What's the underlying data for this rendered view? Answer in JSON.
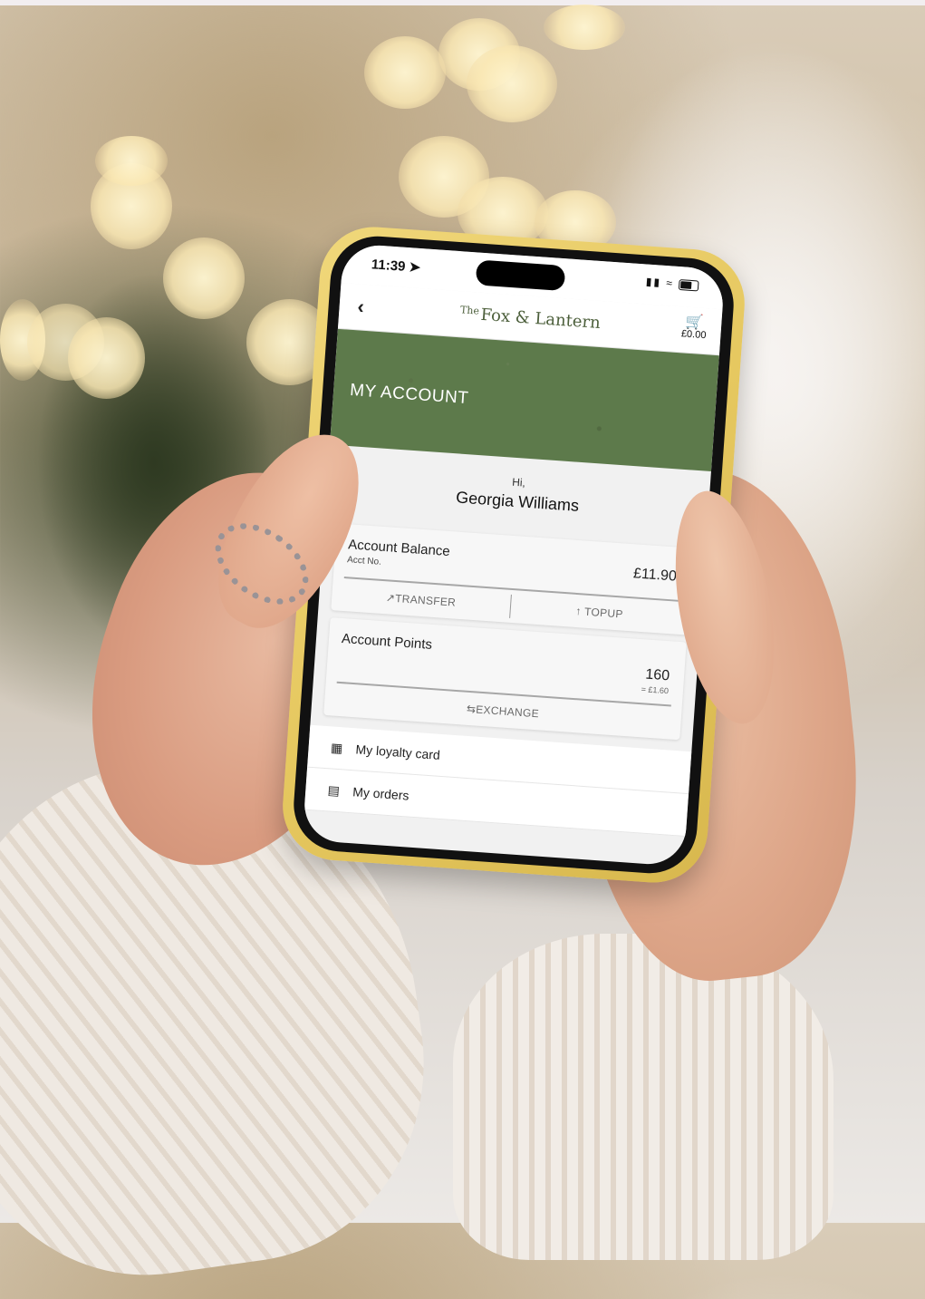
{
  "status_bar": {
    "time": "11:39",
    "location_icon": "location-arrow-icon",
    "signal": "signal-icon",
    "wifi": "wifi-icon",
    "battery": "battery-icon"
  },
  "app_bar": {
    "back_icon": "chevron-left-icon",
    "logo": {
      "prefix": "The",
      "name": "Fox & Lantern"
    },
    "basket": {
      "icon": "basket-icon",
      "amount": "£0.00"
    }
  },
  "banner": {
    "title": "MY ACCOUNT",
    "color": "#5d7a4b"
  },
  "greeting": {
    "hi": "Hi,",
    "name": "Georgia Williams"
  },
  "balance_card": {
    "title": "Account Balance",
    "subtitle": "Acct No.",
    "value": "£11.90",
    "actions": [
      {
        "icon": "external-link-icon",
        "label": "TRANSFER"
      },
      {
        "icon": "arrow-up-icon",
        "label": "TOPUP"
      }
    ]
  },
  "points_card": {
    "title": "Account Points",
    "value": "160",
    "equivalent": "= £1.60",
    "action": {
      "icon": "swap-arrows-icon",
      "label": "EXCHANGE"
    }
  },
  "menu": [
    {
      "icon": "grid-icon",
      "label": "My loyalty card"
    },
    {
      "icon": "receipt-icon",
      "label": "My orders"
    }
  ],
  "colors": {
    "phone_case": "#e6c860",
    "brand_green": "#5d7a4b",
    "logo_text": "#4c5f3b"
  }
}
